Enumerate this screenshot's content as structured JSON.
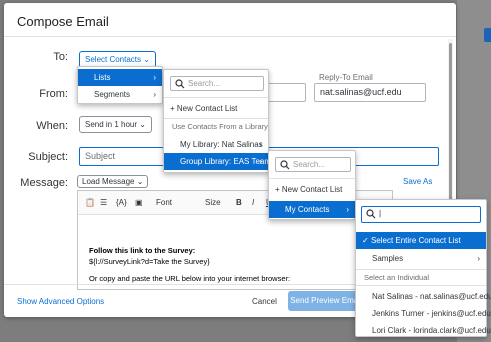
{
  "modal": {
    "title": "Compose Email"
  },
  "form": {
    "to_label": "To:",
    "select_contacts": "Select Contacts",
    "from_label": "From:",
    "reply_to_label": "Reply-To Email",
    "reply_to_value": "nat.salinas@ucf.edu",
    "when_label": "When:",
    "when_value": "Send in 1 hour",
    "subject_label": "Subject:",
    "subject_placeholder": "Subject",
    "message_label": "Message:",
    "load_message": "Load Message",
    "save_as": "Save As"
  },
  "editor": {
    "toolbar": {
      "font": "Font",
      "size": "Size",
      "bold": "B",
      "italic": "I",
      "underline": "U"
    },
    "line1": "Follow this link to the Survey:",
    "line2": "${l://SurveyLink?d=Take the Survey}",
    "line3": "Or copy and paste the URL below into your internet browser:"
  },
  "footer": {
    "advanced": "Show Advanced Options",
    "cancel": "Cancel",
    "send_preview": "Send Preview Email"
  },
  "menu1": {
    "items": [
      {
        "label": "Lists",
        "selected": true
      },
      {
        "label": "Segments",
        "selected": false
      }
    ]
  },
  "menu2": {
    "search_placeholder": "Search...",
    "new_list": "New Contact List",
    "header": "Use Contacts From a Library",
    "items": [
      {
        "label": "My Library: Nat Salinas",
        "selected": false
      },
      {
        "label": "Group Library: EAS Team",
        "selected": true
      }
    ]
  },
  "menu3": {
    "search_placeholder": "Search...",
    "new_list": "New Contact List",
    "items": [
      {
        "label": "My Contacts",
        "selected": true
      }
    ]
  },
  "menu4": {
    "search_value": "|",
    "select_entire": "Select Entire Contact List",
    "samples": "Samples",
    "header": "Select an Individual",
    "people": [
      "Nat Salinas - nat.salinas@ucf.edu",
      "Jenkins Turner - jenkins@ucf.edu",
      "Lori Clark - lorinda.clark@ucf.edu"
    ]
  },
  "colors": {
    "accent": "#0a6ed1",
    "disabled_button": "#7fb2e5"
  }
}
